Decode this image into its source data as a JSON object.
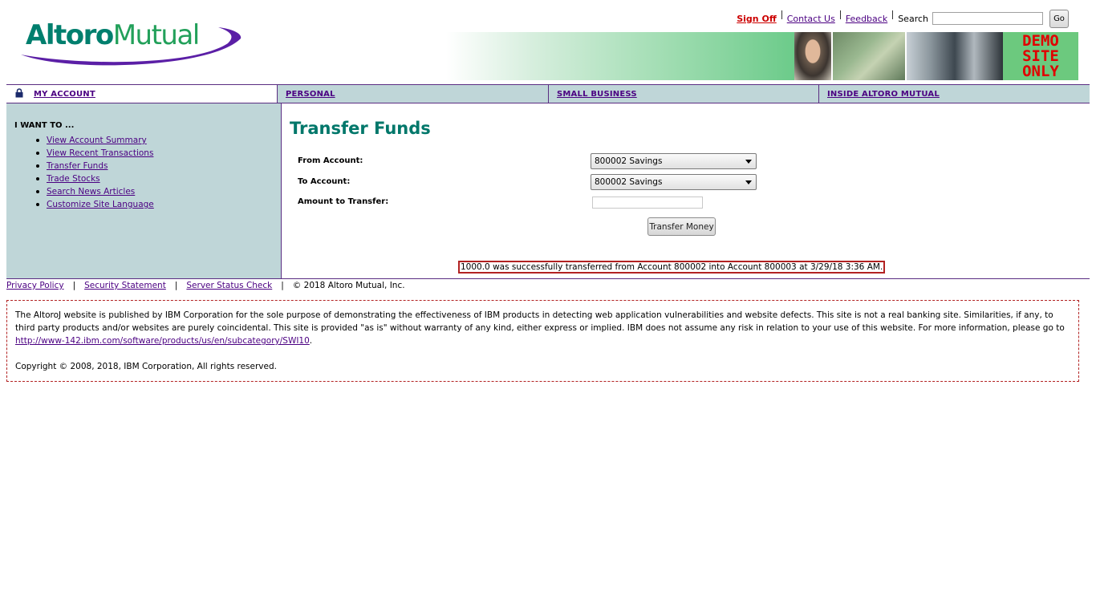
{
  "header": {
    "logo_word1": "Altoro",
    "logo_word2": "Mutual",
    "sign_off": "Sign Off",
    "contact_us": "Contact Us",
    "feedback": "Feedback",
    "search_label": "Search",
    "search_value": "",
    "go_button": "Go",
    "demo_lines": [
      "DEMO",
      "SITE",
      "ONLY"
    ]
  },
  "nav": {
    "tabs": [
      {
        "label": "MY ACCOUNT",
        "active": true
      },
      {
        "label": "PERSONAL"
      },
      {
        "label": "SMALL BUSINESS"
      },
      {
        "label": "INSIDE ALTORO MUTUAL"
      }
    ]
  },
  "sidebar": {
    "heading": "I WANT TO ...",
    "items": [
      "View Account Summary",
      "View Recent Transactions",
      "Transfer Funds",
      "Trade Stocks",
      "Search News Articles",
      "Customize Site Language"
    ]
  },
  "main": {
    "title": "Transfer Funds",
    "from_label": "From Account:",
    "from_value": "800002 Savings",
    "to_label": "To Account:",
    "to_value": "800002 Savings",
    "amount_label": "Amount to Transfer:",
    "amount_value": "",
    "transfer_button": "Transfer Money",
    "message": "1000.0 was successfully transferred from Account 800002 into Account 800003 at 3/29/18 3:36 AM."
  },
  "footer": {
    "privacy": "Privacy Policy",
    "security": "Security Statement",
    "server_status": "Server Status Check",
    "copyright": "© 2018 Altoro Mutual, Inc."
  },
  "disclaimer": {
    "text_before_link": "The AltoroJ website is published by IBM Corporation for the sole purpose of demonstrating the effectiveness of IBM products in detecting web application vulnerabilities and website defects. This site is not a real banking site. Similarities, if any, to third party products and/or websites are purely coincidental. This site is provided \"as is\" without warranty of any kind, either express or implied. IBM does not assume any risk in relation to your use of this website. For more information, please go to ",
    "link": "http://www-142.ibm.com/software/products/us/en/subcategory/SWI10",
    "text_after_link": ".",
    "copyright": "Copyright © 2008, 2018, IBM Corporation, All rights reserved."
  },
  "colors": {
    "brand_teal": "#00776a",
    "brand_purple": "#5a2d82",
    "nav_bg": "#bfd6d8",
    "error_red": "#cc0000"
  }
}
